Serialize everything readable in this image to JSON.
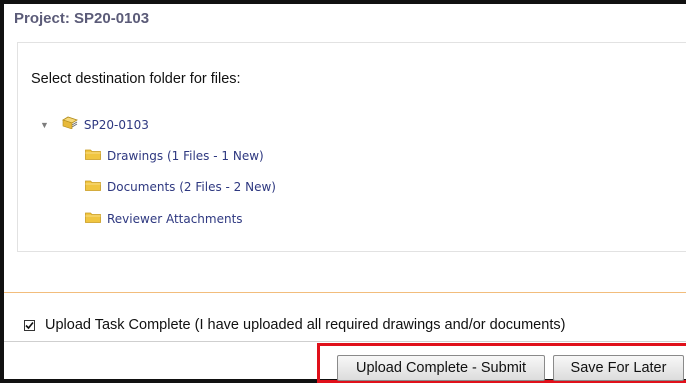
{
  "project": {
    "title": "Project: SP20-0103"
  },
  "panel": {
    "title": "Select destination folder for files:"
  },
  "tree": {
    "root": {
      "label": "SP20-0103",
      "icon": "folder-stack-icon",
      "toggle_icon": "caret-down-icon"
    },
    "children": [
      {
        "label": "Drawings (1 Files - 1 New)",
        "icon": "folder-icon"
      },
      {
        "label": "Documents (2 Files - 2 New)",
        "icon": "folder-icon"
      },
      {
        "label": "Reviewer Attachments",
        "icon": "folder-icon"
      }
    ]
  },
  "upload_task": {
    "checked": true,
    "label": "Upload Task Complete (I have uploaded all required drawings and/or documents)"
  },
  "actions": {
    "submit_label": "Upload Complete - Submit",
    "save_label": "Save For Later"
  },
  "colors": {
    "project_title": "#5b5b78",
    "tree_link": "#2e3880",
    "folder": "#f0c540",
    "highlight_border": "#e0101a",
    "divider_orange": "#f2bd7c"
  }
}
